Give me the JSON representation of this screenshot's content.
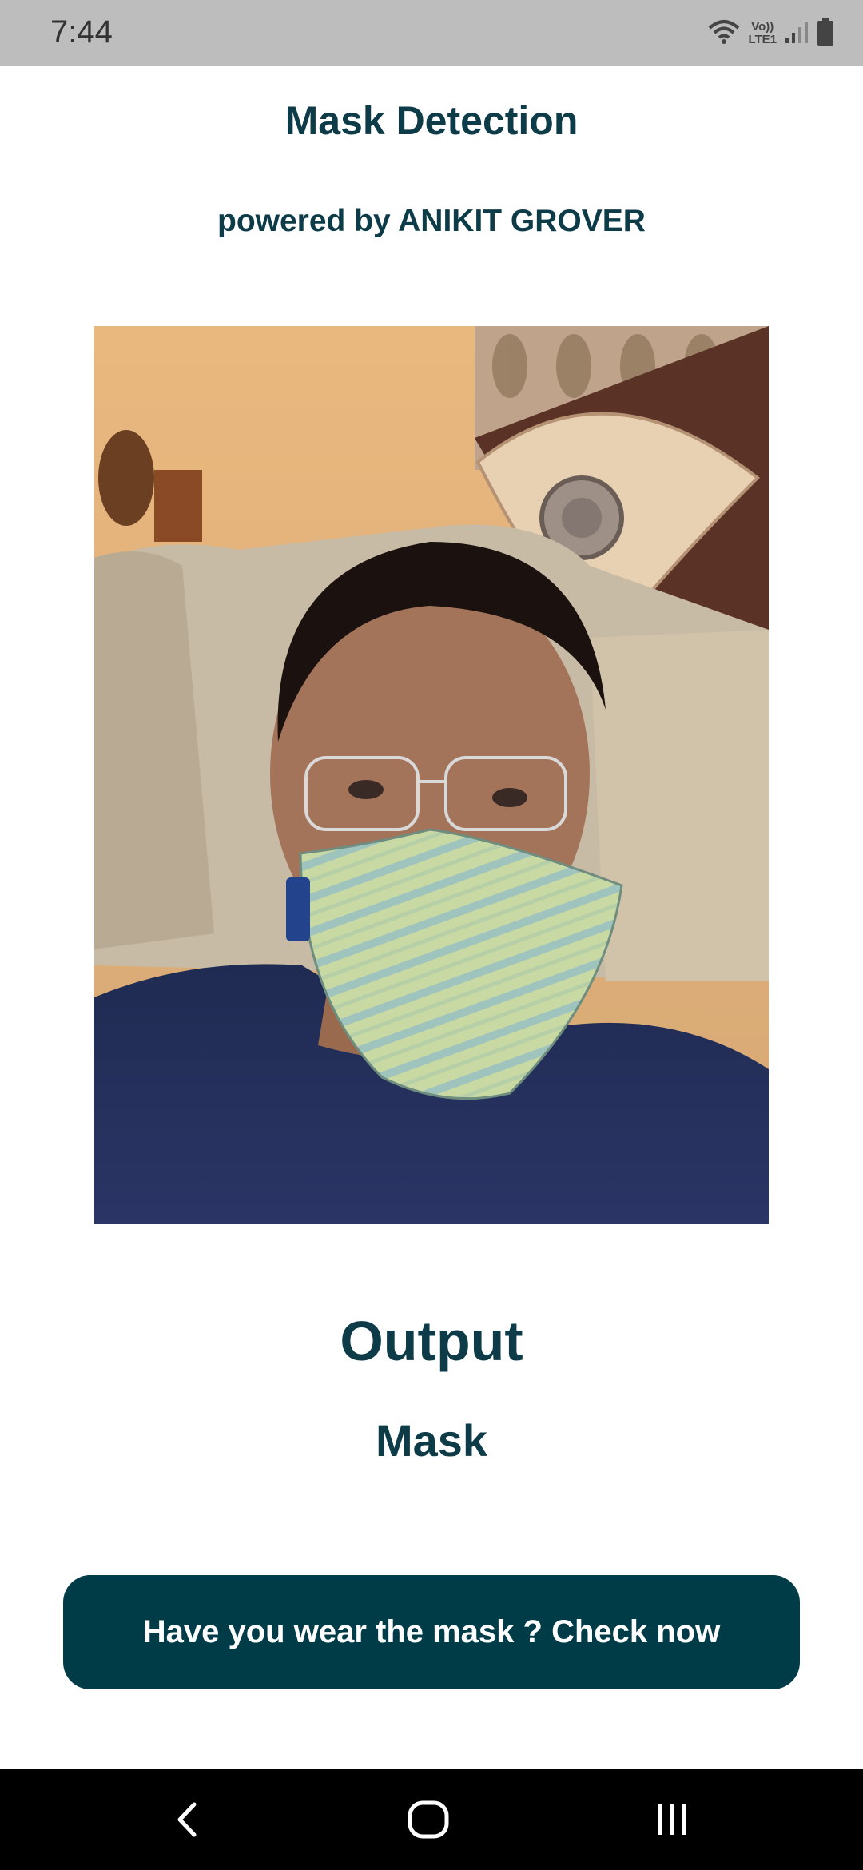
{
  "status_bar": {
    "time": "7:44",
    "network_label_top": "Vo))",
    "network_label_bottom": "LTE1",
    "icons": [
      "wifi-icon",
      "volte-icon",
      "signal-icon",
      "battery-icon"
    ]
  },
  "header": {
    "title": "Mask Detection",
    "subtitle": "powered by ANIKIT GROVER"
  },
  "photo": {
    "description_icon": "selfie-photo"
  },
  "output": {
    "heading": "Output",
    "result": "Mask"
  },
  "action": {
    "button_label": "Have you wear the mask ? Check now"
  },
  "nav": {
    "icons": [
      "back-icon",
      "home-icon",
      "recents-icon"
    ]
  },
  "colors": {
    "primary": "#003c48",
    "text": "#0d3b47",
    "status_bar": "#bdbdbd",
    "nav_bar": "#000000"
  }
}
